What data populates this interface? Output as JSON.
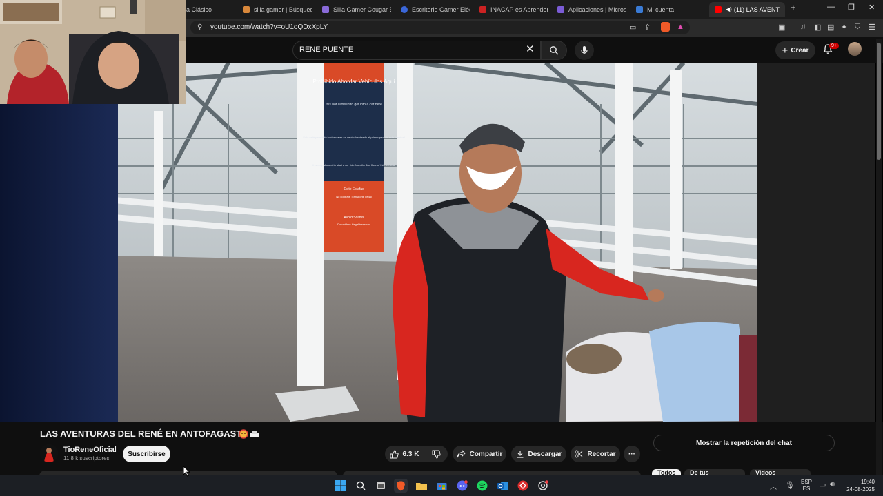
{
  "browser": {
    "tabs": [
      {
        "label": "Gebra Clásico",
        "fav": "#4a6b9a"
      },
      {
        "label": "silla gamer | Búsqueda",
        "fav": "#d9883b"
      },
      {
        "label": "Silla Gamer Cougar Exp",
        "fav": "#8a6bd9"
      },
      {
        "label": "Escritorio Gamer Eléctr",
        "fav": "#3b67d9"
      },
      {
        "label": "INACAP es Aprender H",
        "fav": "#cc2222"
      },
      {
        "label": "Aplicaciones | Microso",
        "fav": "#7b5cd6"
      },
      {
        "label": "Mi cuenta",
        "fav": "#3a7bd5"
      }
    ],
    "active_tab": "(11) LAS AVENT",
    "new_tab": "+",
    "url": "youtube.com/watch?v=oU1oQDxXpLY"
  },
  "youtube": {
    "search_value": "RENE PUENTE",
    "create_label": "Crear",
    "notification_badge": "9+"
  },
  "video": {
    "title": "LAS AVENTURAS DEL RENÉ EN ANTOFAGASTA",
    "channel": "TioReneOficial",
    "subscribers": "11.8 k suscriptores",
    "subscribe_label": "Suscribirse",
    "likes": "6.3 K",
    "share_label": "Compartir",
    "download_label": "Descargar",
    "clip_label": "Recortar",
    "more_label": "···"
  },
  "sidebar": {
    "chat_replay_label": "Mostrar la repetición del chat",
    "chips": [
      "Todos",
      "De tus búsquedas",
      "Videos relacionados"
    ]
  },
  "sign": {
    "title": "Prohibido Abordar Vehículos Aquí",
    "line1": "It is not allowed to get into a car here",
    "line2": "Solo está permitido iniciar viajes en vehículos desde el primer piso de este terminal",
    "line3": "It is only allowed to start a car ride from the first floor of this terminal",
    "red_title": "Evite Estafas",
    "red_line": "No contrate Transporte Ilegal",
    "red_en": "Avoid Scams",
    "red_en_line": "Do not hire illegal transport"
  },
  "taskbar": {
    "lang_top": "ESP",
    "lang_bottom": "ES",
    "time": "19:40",
    "date": "24-08-2025"
  }
}
